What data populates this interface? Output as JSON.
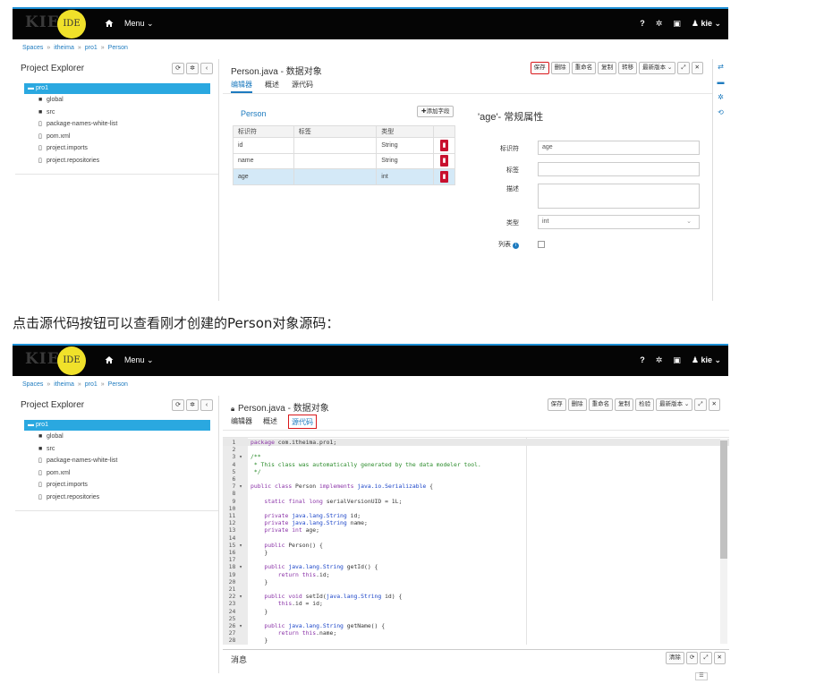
{
  "caption": "点击源代码按钮可以查看刚才创建的Person对象源码：",
  "topbar": {
    "logo": "KIE",
    "logo_badge": "IDE",
    "menu": "Menu",
    "help": "?",
    "user": "kie"
  },
  "breadcrumb": [
    "Spaces",
    "itheima",
    "pro1",
    "Person"
  ],
  "explorer": {
    "title": "Project Explorer",
    "root": "pro1",
    "items": [
      {
        "icon": "folder-icon",
        "label": "global"
      },
      {
        "icon": "folder-icon",
        "label": "src"
      },
      {
        "icon": "file-icon",
        "label": "package-names-white-list"
      },
      {
        "icon": "file-icon",
        "label": "pom.xml"
      },
      {
        "icon": "file-icon",
        "label": "project.imports"
      },
      {
        "icon": "file-icon",
        "label": "project.repositories"
      }
    ]
  },
  "editor": {
    "title": "Person.java - 数据对象",
    "actions1": [
      "保存",
      "删除",
      "重命名",
      "复制",
      "转移",
      "最新版本"
    ],
    "actions2": [
      "保存",
      "删除",
      "重命名",
      "复制",
      "检验",
      "最新版本"
    ],
    "tabs": [
      "编辑器",
      "概述",
      "源代码"
    ]
  },
  "data_object": {
    "class_name": "Person",
    "add_field": "添加字段",
    "columns": [
      "标识符",
      "标签",
      "类型"
    ],
    "fields": [
      {
        "id": "id",
        "label": "",
        "type": "String"
      },
      {
        "id": "name",
        "label": "",
        "type": "String"
      },
      {
        "id": "age",
        "label": "",
        "type": "int"
      }
    ]
  },
  "properties": {
    "title": "'age'- 常规属性",
    "identifier_label": "标识符",
    "identifier_value": "age",
    "label_label": "标签",
    "label_value": "",
    "description_label": "描述",
    "type_label": "类型",
    "type_value": "int",
    "list_label": "列表"
  },
  "source": {
    "lines": [
      "package com.itheima.pro1;",
      "",
      "/**",
      " * This class was automatically generated by the data modeler tool.",
      " */",
      "",
      "public class Person implements java.io.Serializable {",
      "",
      "    static final long serialVersionUID = 1L;",
      "",
      "    private java.lang.String id;",
      "    private java.lang.String name;",
      "    private int age;",
      "",
      "    public Person() {",
      "    }",
      "",
      "    public java.lang.String getId() {",
      "        return this.id;",
      "    }",
      "",
      "    public void setId(java.lang.String id) {",
      "        this.id = id;",
      "    }",
      "",
      "    public java.lang.String getName() {",
      "        return this.name;",
      "    }"
    ],
    "fold_lines": [
      3,
      7,
      15,
      18,
      22,
      26
    ]
  },
  "messages": {
    "title": "消息",
    "clear": "清除"
  }
}
